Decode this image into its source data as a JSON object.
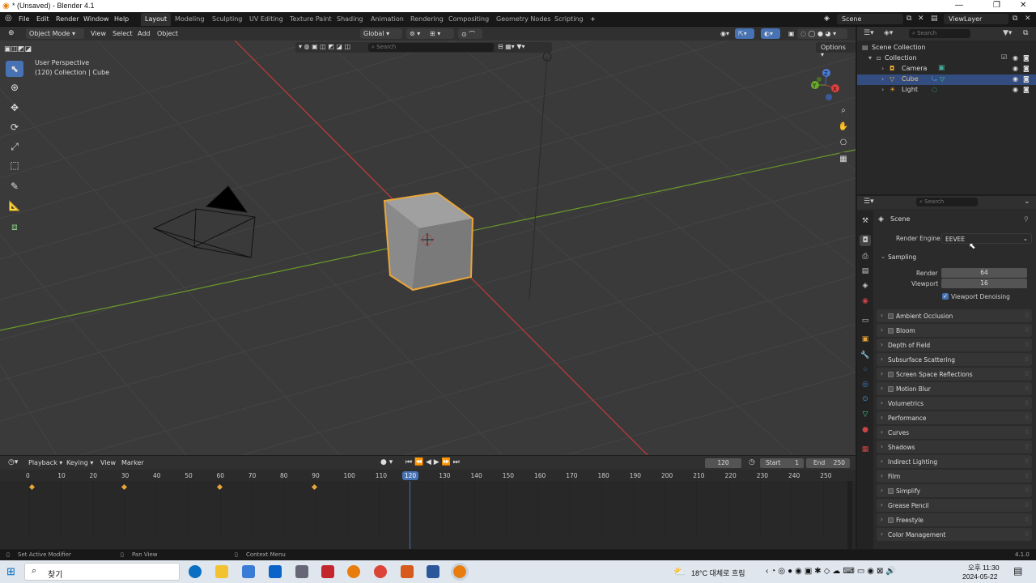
{
  "window": {
    "title": "* (Unsaved) - Blender 4.1",
    "min": "—",
    "max": "❐",
    "close": "✕"
  },
  "menu": [
    "File",
    "Edit",
    "Render",
    "Window",
    "Help"
  ],
  "workspaces": [
    "Layout",
    "Modeling",
    "Sculpting",
    "UV Editing",
    "Texture Paint",
    "Shading",
    "Animation",
    "Rendering",
    "Compositing",
    "Geometry Nodes",
    "Scripting"
  ],
  "add_tab": "+",
  "scene_selector": "Scene",
  "view_layer": "ViewLayer",
  "viewport_header": {
    "mode": "Object Mode",
    "menus": [
      "View",
      "Select",
      "Add",
      "Object"
    ],
    "orientation": "Global",
    "options": "Options",
    "search_placeholder": "Search"
  },
  "viewport": {
    "overlay_line1": "User Perspective",
    "overlay_line2": "(120) Collection | Cube",
    "gizmo": {
      "x": "X",
      "y": "Y",
      "z": "Z"
    }
  },
  "outliner": {
    "search_placeholder": "Search",
    "items": [
      {
        "label": "Scene Collection"
      },
      {
        "label": "Collection"
      },
      {
        "label": "Camera"
      },
      {
        "label": "Cube"
      },
      {
        "label": "Light"
      }
    ]
  },
  "properties": {
    "search_placeholder": "Search",
    "context": "Scene",
    "render_engine_label": "Render Engine",
    "render_engine_value": "EEVEE",
    "sampling": {
      "title": "Sampling",
      "render_label": "Render",
      "render_value": "64",
      "viewport_label": "Viewport",
      "viewport_value": "16",
      "denoise_label": "Viewport Denoising"
    },
    "panels": [
      {
        "label": "Ambient Occlusion",
        "checkbox": true
      },
      {
        "label": "Bloom",
        "checkbox": true
      },
      {
        "label": "Depth of Field",
        "checkbox": false
      },
      {
        "label": "Subsurface Scattering",
        "checkbox": false
      },
      {
        "label": "Screen Space Reflections",
        "checkbox": true
      },
      {
        "label": "Motion Blur",
        "checkbox": true
      },
      {
        "label": "Volumetrics",
        "checkbox": false
      },
      {
        "label": "Performance",
        "checkbox": false
      },
      {
        "label": "Curves",
        "checkbox": false
      },
      {
        "label": "Shadows",
        "checkbox": false
      },
      {
        "label": "Indirect Lighting",
        "checkbox": false
      },
      {
        "label": "Film",
        "checkbox": false
      },
      {
        "label": "Simplify",
        "checkbox": true
      },
      {
        "label": "Grease Pencil",
        "checkbox": false
      },
      {
        "label": "Freestyle",
        "checkbox": true
      },
      {
        "label": "Color Management",
        "checkbox": false
      }
    ]
  },
  "timeline": {
    "menus": [
      "Playback",
      "Keying",
      "View",
      "Marker"
    ],
    "current_frame": "120",
    "start_label": "Start",
    "start_value": "1",
    "end_label": "End",
    "end_value": "250",
    "ticks": [
      "0",
      "10",
      "20",
      "30",
      "40",
      "50",
      "60",
      "70",
      "80",
      "90",
      "100",
      "110",
      "120",
      "130",
      "140",
      "150",
      "160",
      "170",
      "180",
      "190",
      "200",
      "210",
      "220",
      "230",
      "240",
      "250"
    ],
    "keyframes": [
      1,
      30,
      60,
      90
    ],
    "ruler_frame": "120"
  },
  "statusbar": {
    "left": "Set Active Modifier",
    "middle": "Pan View",
    "right": "Context Menu",
    "version": "4.1.0"
  },
  "taskbar": {
    "search": "찾기",
    "weather": "18°C 대체로 흐림",
    "time": "오후 11:30",
    "date": "2024-05-22"
  },
  "colors": {
    "accent": "#4772b3",
    "selection": "#e8a63a",
    "x_axis": "#c23a3a",
    "y_axis": "#6a9a2a"
  }
}
